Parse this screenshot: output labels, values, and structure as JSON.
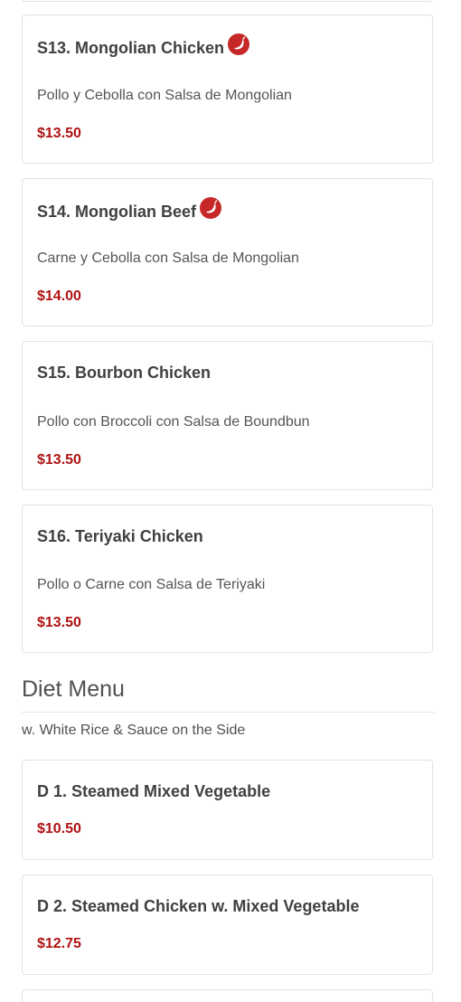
{
  "menu_items": [
    {
      "title": "S13. Mongolian Chicken",
      "spicy": true,
      "description": "Pollo y Cebolla con Salsa de Mongolian",
      "price": "$13.50"
    },
    {
      "title": "S14. Mongolian Beef",
      "spicy": true,
      "description": "Carne y Cebolla con Salsa de Mongolian",
      "price": "$14.00"
    },
    {
      "title": "S15. Bourbon Chicken",
      "spicy": false,
      "description": "Pollo con Broccoli con Salsa de Boundbun",
      "price": "$13.50"
    },
    {
      "title": "S16. Teriyaki Chicken",
      "spicy": false,
      "description": "Pollo o Carne con Salsa de Teriyaki",
      "price": "$13.50"
    }
  ],
  "diet_section": {
    "title": "Diet Menu",
    "subtitle": "w. White Rice & Sauce on the Side",
    "items": [
      {
        "title": "D 1. Steamed Mixed Vegetable",
        "price": "$10.50"
      },
      {
        "title": "D 2. Steamed Chicken w. Mixed Vegetable",
        "price": "$12.75"
      }
    ]
  },
  "icons": {
    "spicy": "hot-pepper-icon"
  },
  "colors": {
    "price": "#b01212",
    "spicy_icon": "#c62828",
    "text": "#404040",
    "border": "#e2e2e2"
  }
}
